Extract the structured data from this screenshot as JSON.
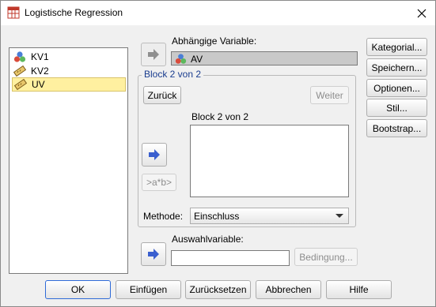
{
  "window": {
    "title": "Logistische Regression"
  },
  "variables": {
    "items": [
      {
        "label": "KV1",
        "icon": "nominal-variable-icon"
      },
      {
        "label": "KV2",
        "icon": "scale-variable-icon"
      },
      {
        "label": "UV",
        "icon": "scale-variable-icon",
        "selected": true
      }
    ]
  },
  "dependent": {
    "label": "Abhängige Variable:",
    "value": "AV",
    "icon": "nominal-variable-icon"
  },
  "block": {
    "legend": "Block 2 von 2",
    "inner_label": "Block 2 von 2",
    "back_label": "Zurück",
    "next_label": "Weiter",
    "interaction_label": ">a*b>"
  },
  "method": {
    "label": "Methode:",
    "value": "Einschluss"
  },
  "selection": {
    "label": "Auswahlvariable:",
    "value": "",
    "condition_label": "Bedingung..."
  },
  "side_buttons": [
    {
      "name": "categorical-button",
      "label": "Kategorial..."
    },
    {
      "name": "save-button",
      "label": "Speichern..."
    },
    {
      "name": "options-button",
      "label": "Optionen..."
    },
    {
      "name": "style-button",
      "label": "Stil..."
    },
    {
      "name": "bootstrap-button",
      "label": "Bootstrap..."
    }
  ],
  "bottom_buttons": {
    "ok": "OK",
    "paste": "Einfügen",
    "reset": "Zurücksetzen",
    "cancel": "Abbrechen",
    "help": "Hilfe"
  },
  "colors": {
    "accent": "#2f6bd8",
    "arrow_blue": "#3a5fcf",
    "selection": "#fff0a0"
  }
}
